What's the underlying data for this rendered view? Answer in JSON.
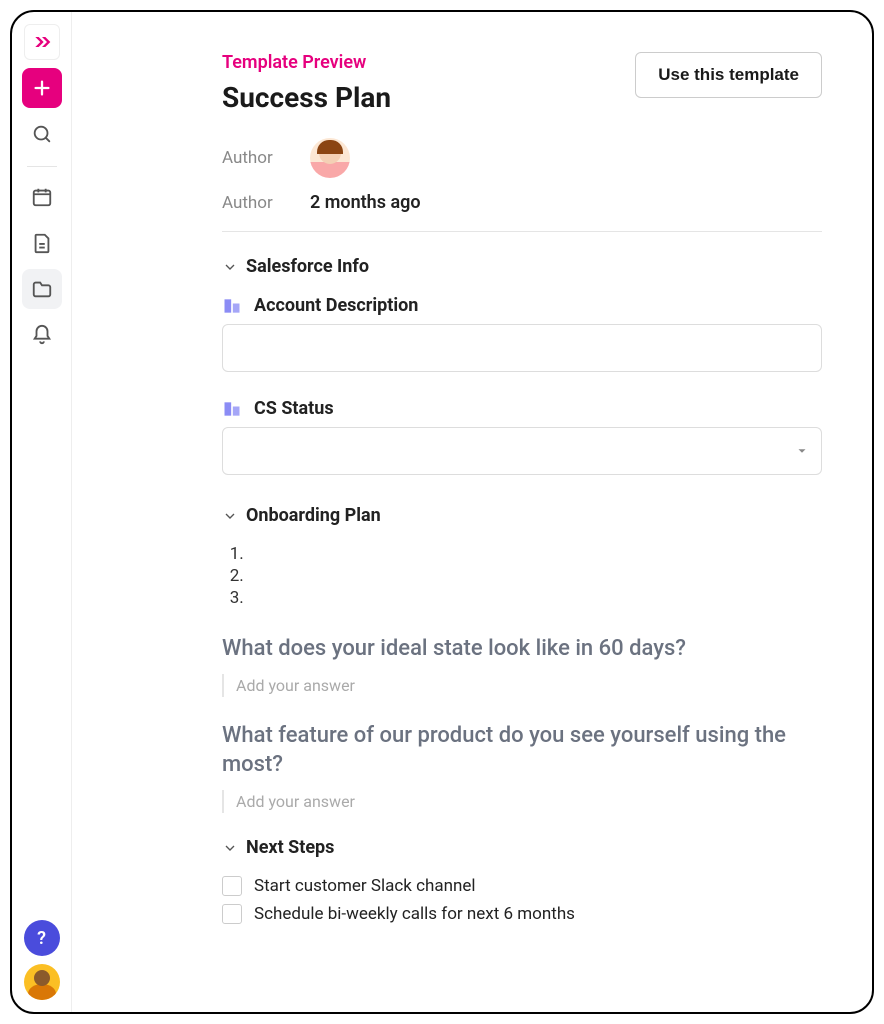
{
  "sidebar": {
    "items": [
      "logo",
      "add",
      "search",
      "divider",
      "calendar",
      "document",
      "folder",
      "bell"
    ],
    "help_label": "?",
    "active": "folder"
  },
  "header": {
    "breadcrumb": "Template Preview",
    "title": "Success Plan",
    "use_button": "Use this template"
  },
  "meta": {
    "author_label": "Author",
    "updated_label": "Author",
    "updated_value": "2 months ago"
  },
  "sections": {
    "salesforce": {
      "title": "Salesforce Info",
      "fields": [
        {
          "label": "Account Description",
          "type": "text",
          "value": ""
        },
        {
          "label": "CS Status",
          "type": "select",
          "value": ""
        }
      ]
    },
    "onboarding": {
      "title": "Onboarding Plan",
      "steps": [
        "",
        "",
        ""
      ],
      "questions": [
        {
          "q": "What does your ideal state look like in 60 days?",
          "placeholder": "Add your answer"
        },
        {
          "q": "What feature of our product do you see yourself using the most?",
          "placeholder": "Add your answer"
        }
      ]
    },
    "next_steps": {
      "title": "Next Steps",
      "items": [
        {
          "label": "Start customer Slack channel",
          "checked": false
        },
        {
          "label": "Schedule bi-weekly calls for next 6 months",
          "checked": false
        }
      ]
    }
  }
}
